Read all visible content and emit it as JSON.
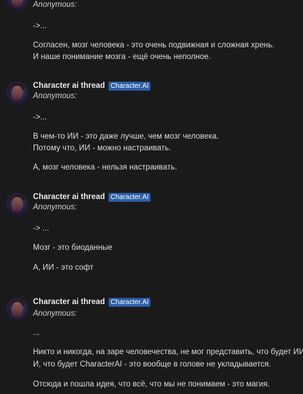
{
  "posts": [
    {
      "quote": "Anonymous:",
      "lines": [
        "->...",
        "Согласен, мозг человека - это очень подвижная и сложная хрень.",
        "И наше понимание мозга - ещё очень неполное."
      ]
    },
    {
      "author": "Character ai thread",
      "badge": "Character.AI",
      "quote": "Anonymous:",
      "lines": [
        "->...",
        "В чем-то ИИ - это даже лучше, чем мозг человека.",
        "Потому что, ИИ - можно настраивать.",
        "А, мозг человека - нельзя настраивать."
      ]
    },
    {
      "author": "Character ai thread",
      "badge": "Character.AI",
      "quote": "Anonymous:",
      "lines": [
        "-> ...",
        "Мозг - это биоданные",
        "А, ИИ - это софт"
      ]
    },
    {
      "author": "Character ai thread",
      "badge": "Character.AI",
      "quote": "Anonymous:",
      "lines": [
        "...",
        "Никто и никогда, на заре человечества, не мог представить, что будет ИИ.",
        "И, что будет CharacterAI - это вообще в голове не укладывается.",
        "Отсюда и пошла идея, что всё, что мы не понимаем - это магия."
      ]
    }
  ]
}
